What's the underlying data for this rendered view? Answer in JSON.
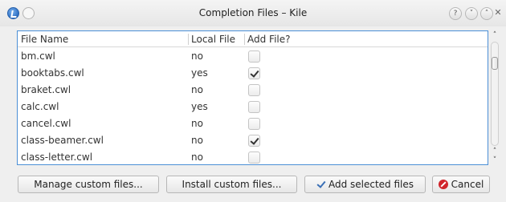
{
  "window": {
    "title": "Completion Files – Kile",
    "help_glyph": "?",
    "min_glyph": "˅",
    "max_glyph": "˄",
    "close_glyph": "✕"
  },
  "table": {
    "columns": [
      "File Name",
      "Local File",
      "Add File?"
    ],
    "rows": [
      {
        "name": "bm.cwl",
        "local": "no",
        "add": false
      },
      {
        "name": "booktabs.cwl",
        "local": "yes",
        "add": true
      },
      {
        "name": "braket.cwl",
        "local": "no",
        "add": false
      },
      {
        "name": "calc.cwl",
        "local": "yes",
        "add": false
      },
      {
        "name": "cancel.cwl",
        "local": "no",
        "add": false
      },
      {
        "name": "class-beamer.cwl",
        "local": "no",
        "add": true
      },
      {
        "name": "class-letter.cwl",
        "local": "no",
        "add": false
      }
    ]
  },
  "scrollbar": {
    "up_glyph": "˄",
    "down_glyph_1": "˄",
    "down_glyph_2": "˅"
  },
  "buttons": {
    "manage": "Manage custom files...",
    "install": "Install custom files...",
    "add": "Add selected files",
    "cancel": "Cancel"
  },
  "icons": {
    "app": "kile-app-icon",
    "shade": "shade-icon",
    "add": "checkmark-icon",
    "cancel": "cancel-icon"
  }
}
